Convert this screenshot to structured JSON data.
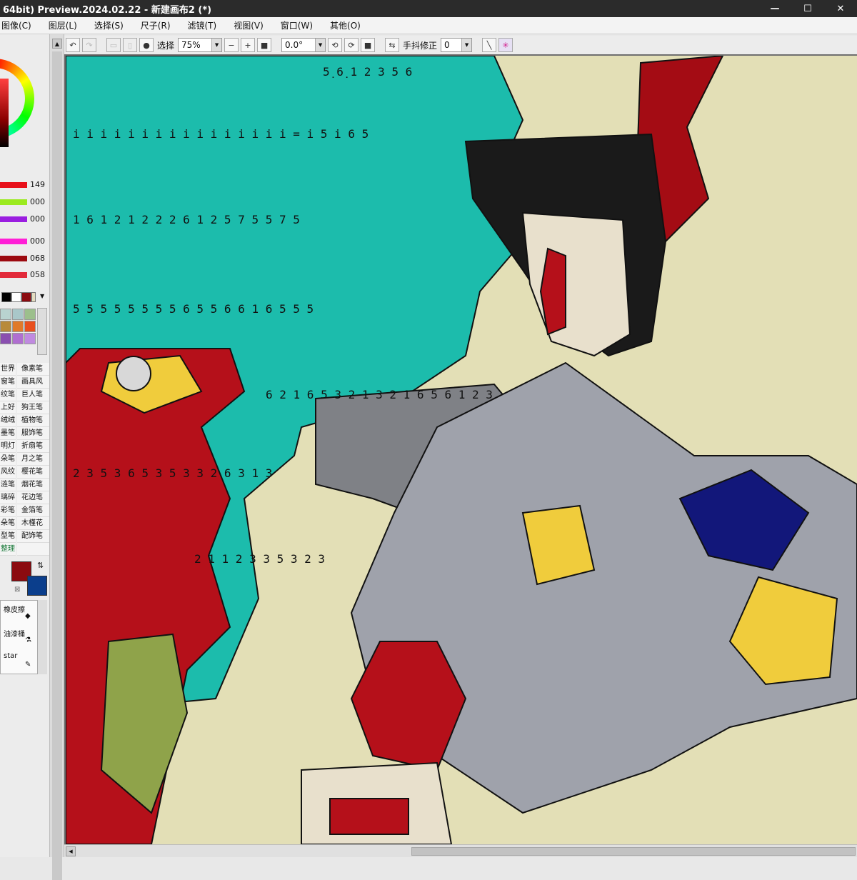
{
  "window": {
    "title": "64bit) Preview.2024.02.22 - 新建画布2 (*)",
    "controls": [
      "—",
      "☐",
      "✕"
    ]
  },
  "menu": [
    "图像(C)",
    "图层(L)",
    "选择(S)",
    "尺子(R)",
    "滤镜(T)",
    "视图(V)",
    "窗口(W)",
    "其他(O)"
  ],
  "toolbar": {
    "selection_label": "选择",
    "zoom": "75%",
    "minus": "−",
    "plus": "+",
    "reset_zoom": "■",
    "angle": "0.0°",
    "rot_left": "⟲",
    "rot_right": "⟳",
    "reset_rot": "■",
    "flip": "⇆",
    "stabilizer_label": "手抖修正",
    "stabilizer_value": "0"
  },
  "colors": {
    "slider_values": [
      "149",
      "000",
      "000",
      "000",
      "068",
      "058"
    ],
    "slider_colors": [
      "#e8101a",
      "#9bea1f",
      "#9a1ee0",
      "#ff1fd6",
      "#9c0a10",
      "#e22a3a"
    ],
    "foreground": "#8b0b10",
    "background": "#0b3e8c",
    "swatches": [
      "#000000",
      "#ffffff",
      "#8b0b10",
      "#e4dcc0"
    ],
    "palette": [
      "#b9d3d0",
      "#a9c7c9",
      "#9cbf8c",
      "#b88a3a",
      "#e07a2a",
      "#e8501e",
      "#8a4fb0",
      "#b06fd0",
      "#c08ae0"
    ]
  },
  "brushes": {
    "left": [
      "世界",
      "窗笔",
      "纹笔",
      "上好",
      "绒绒",
      "墨笔",
      "明灯",
      "朵笔",
      "风纹",
      "涟笔",
      "璃碎",
      "彩笔",
      "朵笔",
      "型笔",
      "整理"
    ],
    "right": [
      "像素笔",
      "画具风",
      "巨人笔",
      "狗王笔",
      "植物笔",
      "服饰笔",
      "折扇笔",
      "月之笔",
      "樱花笔",
      "烟花笔",
      "花边笔",
      "金箔笔",
      "木槿花",
      "配饰笔"
    ]
  },
  "tools": {
    "items": [
      "橡皮擦",
      "油漆桶",
      "star"
    ]
  },
  "music": {
    "rows": [
      "5̣ 6̣ 1 2 3 5 6",
      "i i i i i  i i i i   i i i i   i  i   i  =  i  5  i  6  5",
      "1 6  1 2 1   2 2 2   6 1 2   5 7 5   5 7 5",
      "5 5   5 5 5 5 5   5 6 5   5 6   6 1 6   5 5 5",
      "6 2 1 6   5 3 2 1   3 2 1 6   5 6 1 2 3",
      "2 3 5 3   6 5 3   5 3 3 2   6 3   1 3",
      "2 1   1 2 3   3 5 3   2 3"
    ]
  }
}
